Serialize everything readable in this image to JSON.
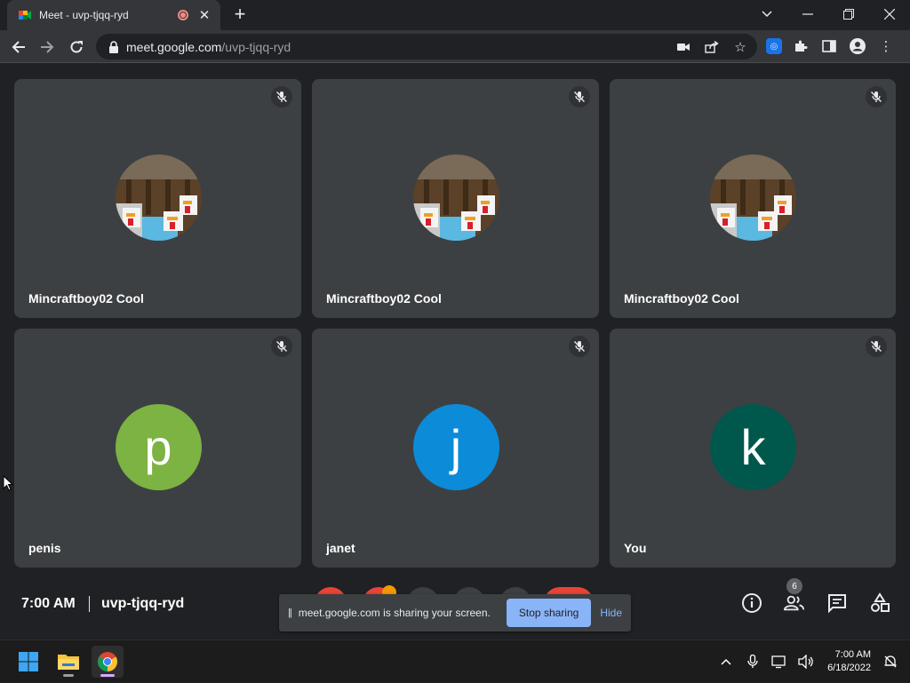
{
  "browser": {
    "tab_title": "Meet - uvp-tjqq-ryd",
    "new_tab_icon": "plus-icon",
    "url_host": "meet.google.com",
    "url_path": "/uvp-tjqq-ryd"
  },
  "tiles": [
    {
      "name": "Mincraftboy02 Cool",
      "avatar_type": "image"
    },
    {
      "name": "Mincraftboy02 Cool",
      "avatar_type": "image"
    },
    {
      "name": "Mincraftboy02 Cool",
      "avatar_type": "image"
    },
    {
      "name": "penis",
      "initial": "p",
      "color": "#7cb342"
    },
    {
      "name": "janet",
      "initial": "j",
      "color": "#0b8bd8"
    },
    {
      "name": "You",
      "initial": "k",
      "color": "#00574b"
    }
  ],
  "meeting": {
    "time": "7:00 AM",
    "code": "uvp-tjqq-ryd",
    "participant_count": "6"
  },
  "share_banner": {
    "message": "meet.google.com is sharing your screen.",
    "stop_label": "Stop sharing",
    "hide_label": "Hide"
  },
  "taskbar": {
    "time": "7:00 AM",
    "date": "6/18/2022"
  },
  "colors": {
    "meet_bg": "#202124",
    "tile_bg": "#3c4043",
    "accent_blue": "#8ab4f8",
    "leave_red": "#ea4335"
  }
}
